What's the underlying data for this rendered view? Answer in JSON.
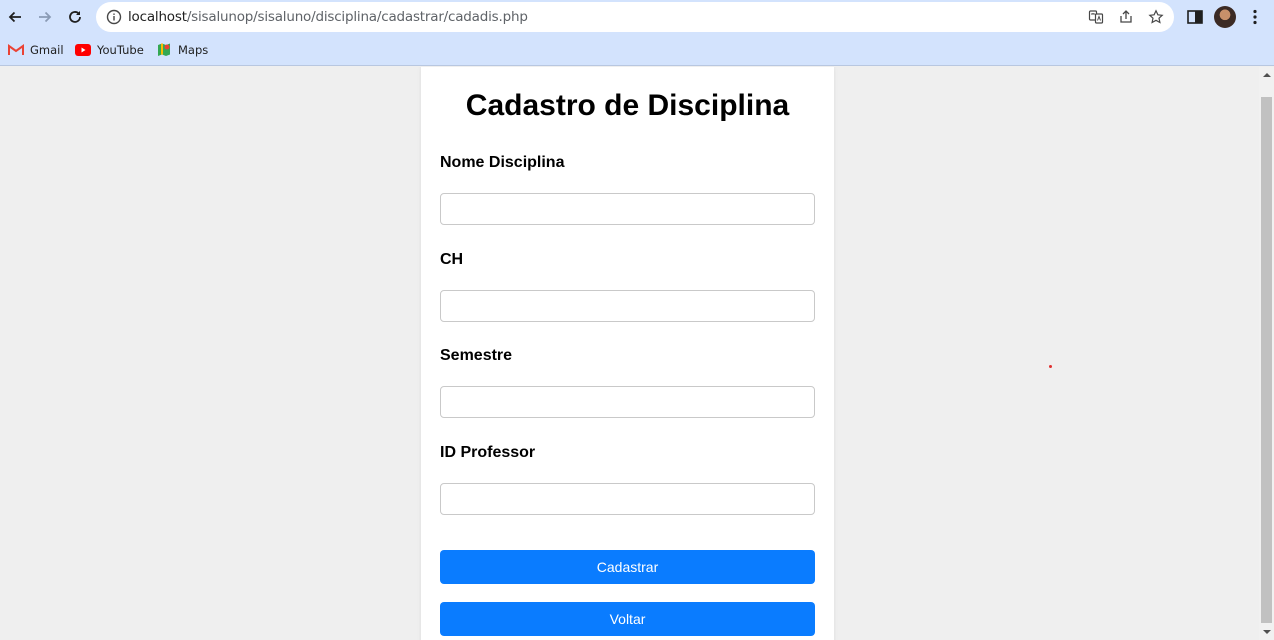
{
  "browser": {
    "url_host": "localhost",
    "url_path": "/sisalunop/sisaluno/disciplina/cadastrar/cadadis.php",
    "bookmarks": [
      {
        "label": "Gmail",
        "icon": "gmail-icon"
      },
      {
        "label": "YouTube",
        "icon": "youtube-icon"
      },
      {
        "label": "Maps",
        "icon": "maps-icon"
      }
    ]
  },
  "form": {
    "title": "Cadastro de Disciplina",
    "fields": [
      {
        "label": "Nome Disciplina",
        "value": ""
      },
      {
        "label": "CH",
        "value": ""
      },
      {
        "label": "Semestre",
        "value": ""
      },
      {
        "label": "ID Professor",
        "value": ""
      }
    ],
    "submit_label": "Cadastrar",
    "back_label": "Voltar"
  },
  "colors": {
    "accent": "#0a7cff",
    "chrome": "#d3e3fd",
    "page_bg": "#efefef"
  }
}
